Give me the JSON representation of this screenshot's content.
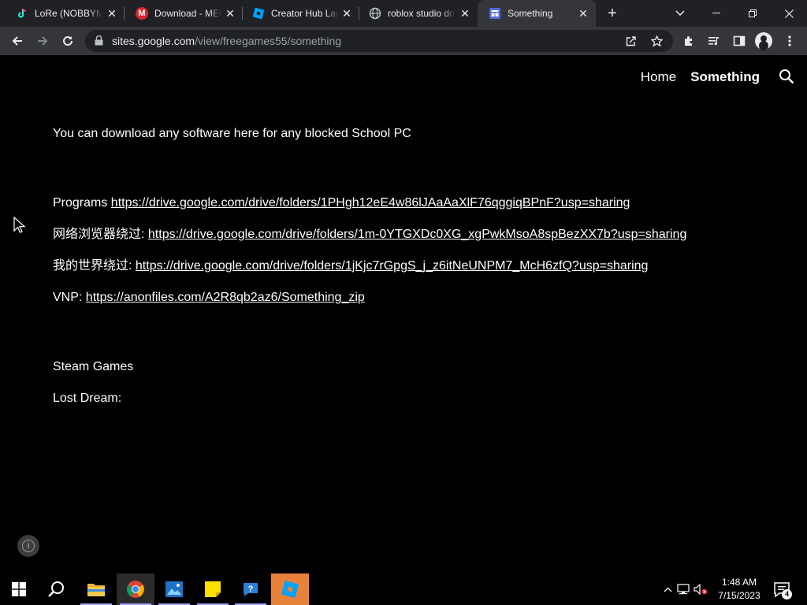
{
  "tabs": [
    {
      "title": "LoRe (NOBBYMU",
      "favicon": "tiktok-icon",
      "color": "#000000"
    },
    {
      "title": "Download - MEG",
      "favicon": "mega-icon",
      "color": "#d9272e"
    },
    {
      "title": "Creator Hub Lan",
      "favicon": "roblox-studio-icon",
      "color": "#00a2ff"
    },
    {
      "title": "roblox studio do",
      "favicon": "globe-icon",
      "color": "#9aa0a6"
    },
    {
      "title": "Something",
      "favicon": "google-sites-icon",
      "color": "#4f6bed"
    }
  ],
  "toolbar": {
    "url_host": "sites.google.com",
    "url_path": "/view/freegames55/something"
  },
  "site": {
    "nav": [
      {
        "label": "Home"
      },
      {
        "label": "Something"
      }
    ],
    "intro": "You can download any software here for any blocked School PC",
    "links": [
      {
        "label": "Programs ",
        "url": "https://drive.google.com/drive/folders/1PHgh12eE4w86lJAaAaXlF76qggiqBPnF?usp=sharing"
      },
      {
        "label": "网络浏览器绕过: ",
        "url": "https://drive.google.com/drive/folders/1m-0YTGXDc0XG_xgPwkMsoA8spBezXX7b?usp=sharing"
      },
      {
        "label": "我的世界绕过: ",
        "url": "https://drive.google.com/drive/folders/1jKjc7rGpgS_j_z6itNeUNPM7_McH6zfQ?usp=sharing"
      },
      {
        "label": "VNP: ",
        "url": "https://anonfiles.com/A2R8qb2az6/Something_zip"
      }
    ],
    "section_heading": "Steam Games",
    "lost_dream_label": "Lost Dream:"
  },
  "taskbar": {
    "time": "1:48 AM",
    "date": "7/15/2023",
    "notification_count": "4"
  }
}
